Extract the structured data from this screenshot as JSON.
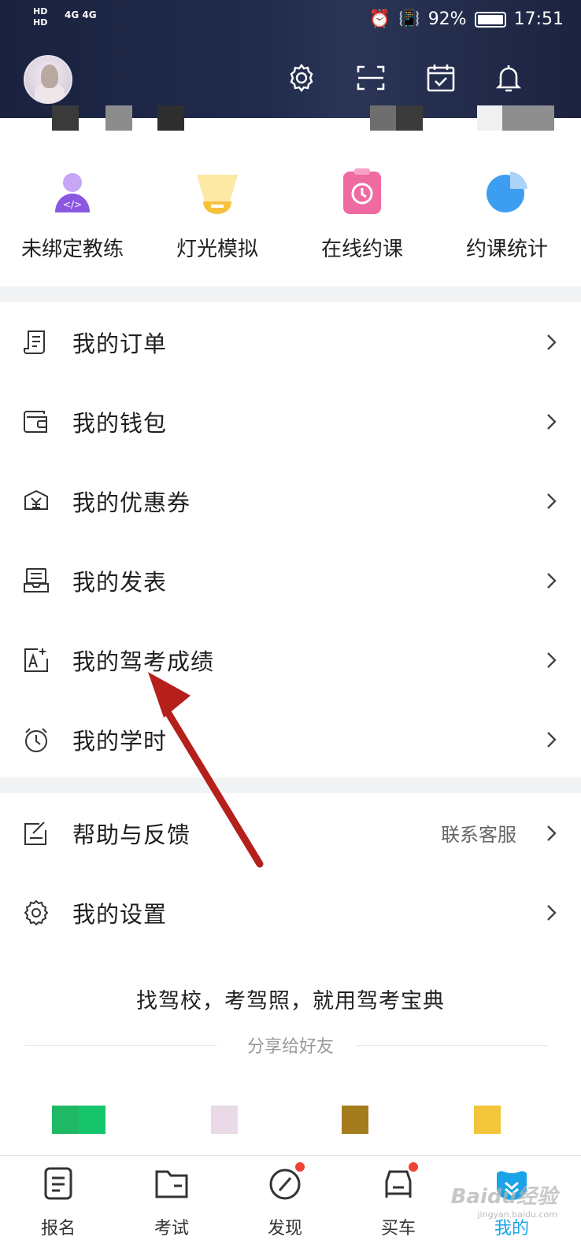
{
  "status_bar": {
    "network_left": "HD 1\nHD 2",
    "signal": "4G 4G",
    "battery": "92%",
    "time": "17:51"
  },
  "header_icons": [
    "settings-icon",
    "scan-icon",
    "calendar-check-icon",
    "bell-icon"
  ],
  "features": [
    {
      "label": "未绑定教练",
      "icon": "coach-icon",
      "color": "#8a58e0"
    },
    {
      "label": "灯光模拟",
      "icon": "light-sim-icon",
      "color": "#f6c23c"
    },
    {
      "label": "在线约课",
      "icon": "clock-clipboard-icon",
      "color": "#ef6aa0"
    },
    {
      "label": "约课统计",
      "icon": "pie-chart-icon",
      "color": "#3d9df0"
    }
  ],
  "menu": [
    {
      "label": "我的订单",
      "icon": "order-icon",
      "extra": ""
    },
    {
      "label": "我的钱包",
      "icon": "wallet-icon",
      "extra": ""
    },
    {
      "label": "我的优惠券",
      "icon": "coupon-icon",
      "extra": ""
    },
    {
      "label": "我的发表",
      "icon": "post-icon",
      "extra": ""
    },
    {
      "label": "我的驾考成绩",
      "icon": "score-icon",
      "extra": ""
    },
    {
      "label": "我的学时",
      "icon": "timer-icon",
      "extra": ""
    }
  ],
  "menu2": [
    {
      "label": "帮助与反馈",
      "icon": "feedback-icon",
      "extra": "联系客服"
    },
    {
      "label": "我的设置",
      "icon": "gear-icon",
      "extra": ""
    }
  ],
  "slogan": "找驾校，考驾照，就用驾考宝典",
  "share_label": "分享给好友",
  "tabs": [
    {
      "label": "报名",
      "icon": "signup-icon",
      "dot": false,
      "active": false
    },
    {
      "label": "考试",
      "icon": "folder-icon",
      "dot": false,
      "active": false
    },
    {
      "label": "发现",
      "icon": "compass-icon",
      "dot": true,
      "active": false
    },
    {
      "label": "买车",
      "icon": "car-icon",
      "dot": true,
      "active": false
    },
    {
      "label": "我的",
      "icon": "me-icon",
      "dot": false,
      "active": true
    }
  ],
  "colors": {
    "accent": "#1aa3e8",
    "header_bg": "#1d2443",
    "badge": "#f04234",
    "arrow": "#b5201a"
  }
}
